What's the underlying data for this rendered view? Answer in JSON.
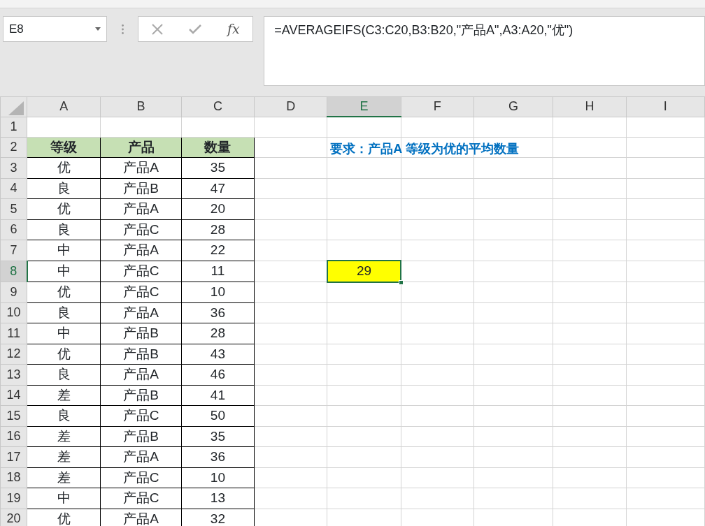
{
  "formula_bar": {
    "name_box": "E8",
    "function_label": "fx",
    "formula": "=AVERAGEIFS(C3:C20,B3:B20,\"产品A\",A3:A20,\"优\")"
  },
  "sheet": {
    "columns": [
      {
        "label": "A",
        "selected": false
      },
      {
        "label": "B",
        "selected": false
      },
      {
        "label": "C",
        "selected": false
      },
      {
        "label": "D",
        "selected": false
      },
      {
        "label": "E",
        "selected": true
      },
      {
        "label": "F",
        "selected": false
      },
      {
        "label": "G",
        "selected": false
      },
      {
        "label": "H",
        "selected": false
      },
      {
        "label": "I",
        "selected": false
      }
    ],
    "rows": [
      {
        "label": "1",
        "selected": false
      },
      {
        "label": "2",
        "selected": false
      },
      {
        "label": "3",
        "selected": false
      },
      {
        "label": "4",
        "selected": false
      },
      {
        "label": "5",
        "selected": false
      },
      {
        "label": "6",
        "selected": false
      },
      {
        "label": "7",
        "selected": false
      },
      {
        "label": "8",
        "selected": true
      },
      {
        "label": "9",
        "selected": false
      },
      {
        "label": "10",
        "selected": false
      },
      {
        "label": "11",
        "selected": false
      },
      {
        "label": "12",
        "selected": false
      },
      {
        "label": "13",
        "selected": false
      },
      {
        "label": "14",
        "selected": false
      },
      {
        "label": "15",
        "selected": false
      },
      {
        "label": "16",
        "selected": false
      },
      {
        "label": "17",
        "selected": false
      },
      {
        "label": "18",
        "selected": false
      },
      {
        "label": "19",
        "selected": false
      },
      {
        "label": "20",
        "selected": false
      }
    ],
    "data_table": {
      "header": [
        "等级",
        "产品",
        "数量"
      ],
      "rows": [
        [
          "优",
          "产品A",
          "35"
        ],
        [
          "良",
          "产品B",
          "47"
        ],
        [
          "优",
          "产品A",
          "20"
        ],
        [
          "良",
          "产品C",
          "28"
        ],
        [
          "中",
          "产品A",
          "22"
        ],
        [
          "中",
          "产品C",
          "11"
        ],
        [
          "优",
          "产品C",
          "10"
        ],
        [
          "良",
          "产品A",
          "36"
        ],
        [
          "中",
          "产品B",
          "28"
        ],
        [
          "优",
          "产品B",
          "43"
        ],
        [
          "良",
          "产品A",
          "46"
        ],
        [
          "差",
          "产品B",
          "41"
        ],
        [
          "良",
          "产品C",
          "50"
        ],
        [
          "差",
          "产品B",
          "35"
        ],
        [
          "差",
          "产品A",
          "36"
        ],
        [
          "差",
          "产品C",
          "10"
        ],
        [
          "中",
          "产品C",
          "13"
        ],
        [
          "优",
          "产品A",
          "32"
        ]
      ]
    },
    "note": "要求：产品A 等级为优的平均数量",
    "result": {
      "value": "29",
      "selected": true
    }
  }
}
